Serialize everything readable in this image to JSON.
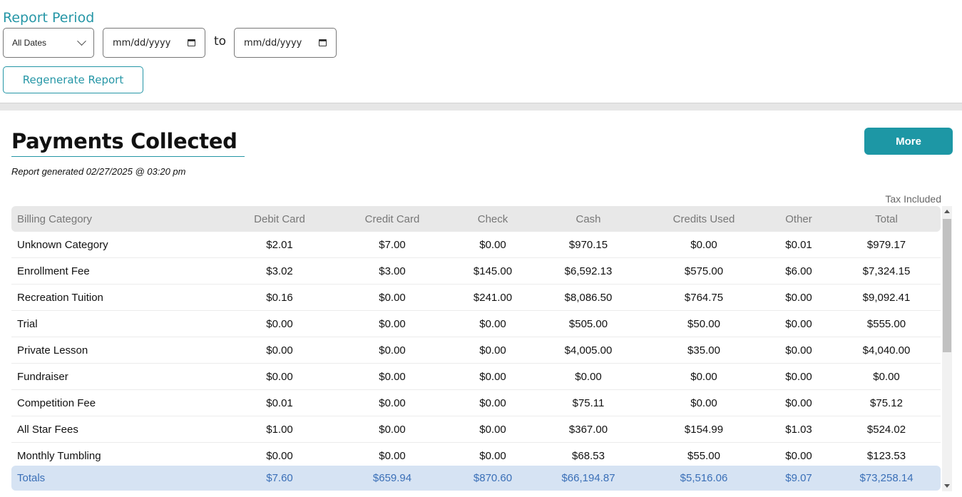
{
  "period": {
    "title": "Report Period",
    "range_select": "All Dates",
    "start_placeholder": "mm/dd/yyyy",
    "end_placeholder": "mm/dd/yyyy",
    "to_label": "to",
    "regenerate_label": "Regenerate Report"
  },
  "report": {
    "title": "Payments Collected",
    "generated": "Report generated 02/27/2025 @ 03:20 pm",
    "more_label": "More",
    "tax_note": "Tax Included"
  },
  "table": {
    "headers": [
      "Billing Category",
      "Debit Card",
      "Credit Card",
      "Check",
      "Cash",
      "Credits Used",
      "Other",
      "Total"
    ],
    "rows": [
      [
        "Unknown Category",
        "$2.01",
        "$7.00",
        "$0.00",
        "$970.15",
        "$0.00",
        "$0.01",
        "$979.17"
      ],
      [
        "Enrollment Fee",
        "$3.02",
        "$3.00",
        "$145.00",
        "$6,592.13",
        "$575.00",
        "$6.00",
        "$7,324.15"
      ],
      [
        "Recreation Tuition",
        "$0.16",
        "$0.00",
        "$241.00",
        "$8,086.50",
        "$764.75",
        "$0.00",
        "$9,092.41"
      ],
      [
        "Trial",
        "$0.00",
        "$0.00",
        "$0.00",
        "$505.00",
        "$50.00",
        "$0.00",
        "$555.00"
      ],
      [
        "Private Lesson",
        "$0.00",
        "$0.00",
        "$0.00",
        "$4,005.00",
        "$35.00",
        "$0.00",
        "$4,040.00"
      ],
      [
        "Fundraiser",
        "$0.00",
        "$0.00",
        "$0.00",
        "$0.00",
        "$0.00",
        "$0.00",
        "$0.00"
      ],
      [
        "Competition Fee",
        "$0.01",
        "$0.00",
        "$0.00",
        "$75.11",
        "$0.00",
        "$0.00",
        "$75.12"
      ],
      [
        "All Star Fees",
        "$1.00",
        "$0.00",
        "$0.00",
        "$367.00",
        "$154.99",
        "$1.03",
        "$524.02"
      ],
      [
        "Monthly Tumbling",
        "$0.00",
        "$0.00",
        "$0.00",
        "$68.53",
        "$55.00",
        "$0.00",
        "$123.53"
      ]
    ],
    "totals": [
      "Totals",
      "$7.60",
      "$659.94",
      "$870.60",
      "$66,194.87",
      "$5,516.06",
      "$9.07",
      "$73,258.14"
    ]
  },
  "colors": {
    "accent": "#2596a6",
    "button": "#1d97a5",
    "totals_bg": "#d6e3f3",
    "totals_text": "#3a6fb7",
    "header_bg": "#e8e8e8"
  }
}
